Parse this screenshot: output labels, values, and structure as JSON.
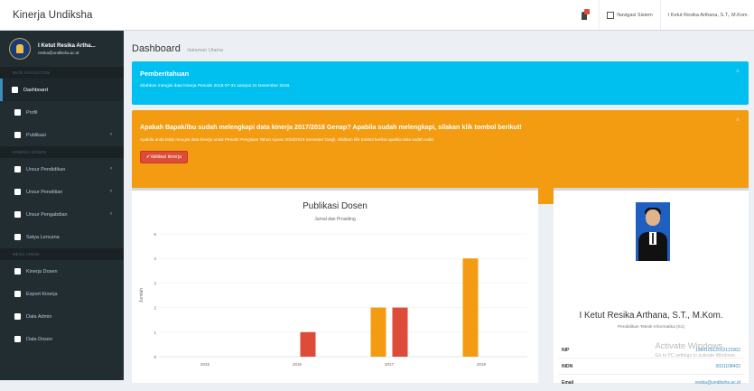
{
  "app": {
    "title": "Kinerja Undiksha"
  },
  "topbar": {
    "nav_system": "Navigasi Sistem",
    "user": "I Ketut Resika Arthana, S.T., M.Kom."
  },
  "sidebar": {
    "user_name": "I Ketut Resika Artha...",
    "user_email": "resika@undiksha.ac.id",
    "sections": {
      "main": "MAIN NAVIGATION",
      "kinerja": "KINERJA DOSEN",
      "admin": "MENU ADMIN"
    },
    "items": [
      {
        "label": "Dashboard",
        "icon": "home-icon"
      },
      {
        "label": "Profil",
        "icon": "user-icon"
      },
      {
        "label": "Publikasi",
        "icon": "table-icon"
      },
      {
        "label": "Unsur Pendidikan",
        "icon": "graduation-cap-icon"
      },
      {
        "label": "Unsur Penelitian",
        "icon": "book-icon"
      },
      {
        "label": "Unsur Pengabdian",
        "icon": "hand-icon"
      },
      {
        "label": "Satya Lencana",
        "icon": "medal-icon"
      },
      {
        "label": "Kinerja Dosen",
        "icon": "university-icon"
      },
      {
        "label": "Export Kinerja",
        "icon": "export-icon"
      },
      {
        "label": "Data Admin",
        "icon": "users-icon"
      },
      {
        "label": "Data Dosen",
        "icon": "users-icon"
      }
    ]
  },
  "header": {
    "title": "Dashboard",
    "subtitle": "Halaman Utama"
  },
  "notification": {
    "title": "Pemberitahuan",
    "text": "Silahkan mengisi data kinerja Periode 2018-07-31 sampai 31 Desember 2018."
  },
  "prompt": {
    "title": "Apakah Bapak/Ibu sudah melengkapi data kinerja 2017/2018 Genap? Apabila sudah melengkapi, silakan klik tombol berikut!",
    "text": "Apabila anda telah mengisi data kinerja untuk Periode Pengisian Tahun Ajaran 2018/2019 Semester Ganjil, silahkan klik tombol berikut apabila data sudah valid.",
    "button": "Validasi kinerja"
  },
  "profile": {
    "name": "I Ketut Resika Arthana, S.T., M.Kom.",
    "dept": "Pendidikan Teknik Informatika (S1)",
    "rows": [
      {
        "label": "NIP",
        "value": "198410312012121002"
      },
      {
        "label": "NIDN",
        "value": "0031108402"
      },
      {
        "label": "Email",
        "value": "resika@undiksha.ac.id"
      }
    ]
  },
  "watermark": {
    "title": "Activate Windows",
    "sub": "Go to PC settings to activate Windows."
  },
  "colors": {
    "sidebar": "#222d32",
    "info": "#00c0ef",
    "warning": "#f39c12",
    "danger": "#dd4b39",
    "orange_bar": "#f39c12",
    "red_bar": "#dd4b39"
  },
  "chart_data": {
    "type": "bar",
    "title": "Publikasi Dosen",
    "subtitle": "Jurnal dan Prosiding",
    "ylabel": "Jumlah",
    "xlabel": "",
    "categories": [
      "2015",
      "2016",
      "2017",
      "2018"
    ],
    "yticks": [
      0,
      1,
      2,
      3,
      4,
      5
    ],
    "ylim": [
      0,
      5
    ],
    "series": [
      {
        "color": "#f39c12",
        "values": [
          0,
          0,
          2,
          4
        ]
      },
      {
        "color": "#dd4b39",
        "values": [
          0,
          1,
          2,
          0
        ]
      }
    ]
  }
}
